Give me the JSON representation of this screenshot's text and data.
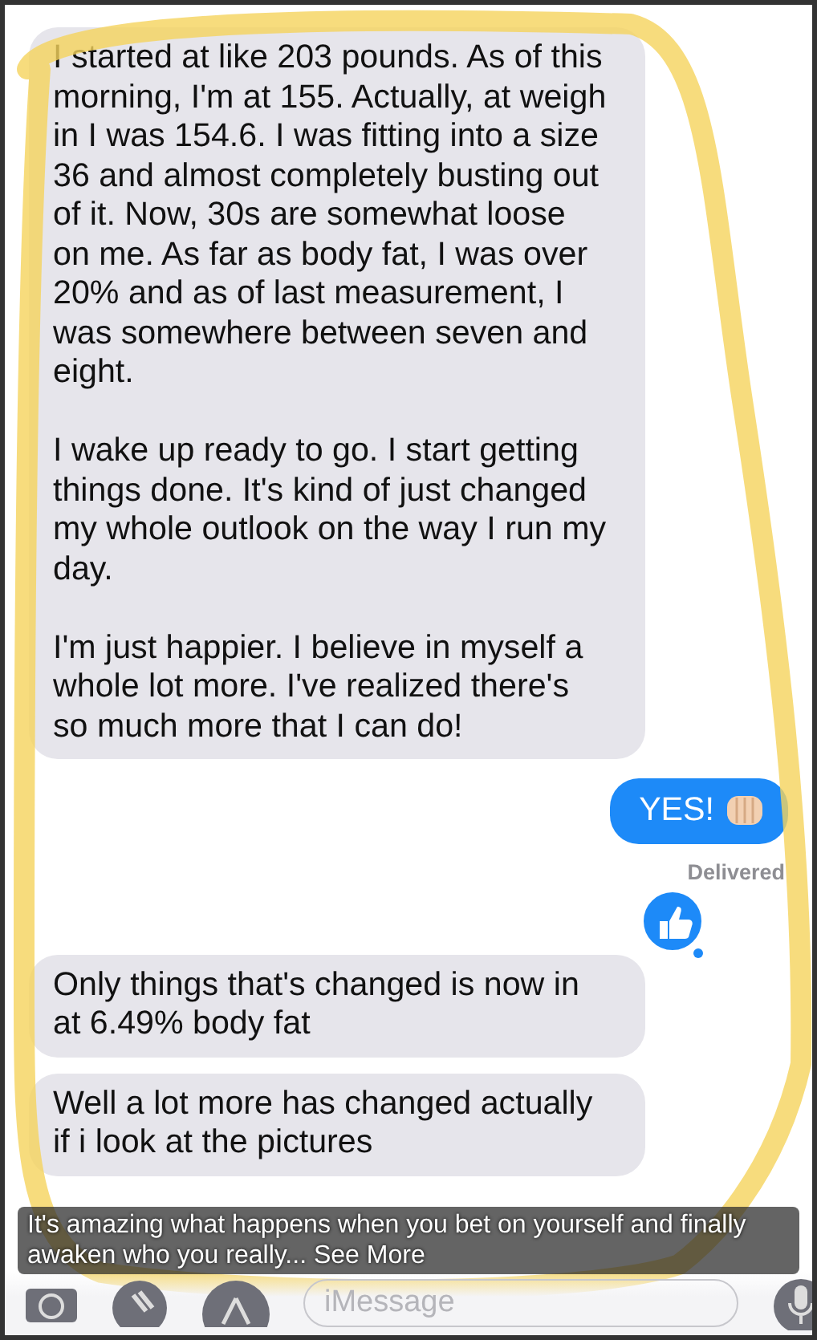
{
  "messages": [
    {
      "kind": "received",
      "paragraphs": [
        "I started at like 203 pounds. As of this morning, I'm at 155. Actually, at weigh in I was 154.6. I was fitting into a size 36 and almost completely busting out of it. Now, 30s are somewhat loose on me. As far as body fat,  I was over 20% and as of last measurement, I was somewhere between seven and eight.",
        "I wake up ready to go. I start getting things done. It's kind of just changed my whole outlook on the way I run my day.",
        "I'm just happier. I believe in myself a whole lot more. I've realized there's so much more that I can do!"
      ],
      "liked": false
    },
    {
      "kind": "sent",
      "paragraphs": [
        "YES!"
      ],
      "status": "Delivered",
      "liked": false
    },
    {
      "kind": "received",
      "paragraphs": [
        "Only things that's changed is now in at 6.49% body fat"
      ],
      "liked": true
    },
    {
      "kind": "received",
      "paragraphs": [
        "Well a lot more has changed actually if i look at the pictures"
      ],
      "liked": false
    }
  ],
  "composer": {
    "placeholder": "iMessage"
  },
  "caption": {
    "text": "It's amazing what happens when you bet on yourself and finally awaken who you really...",
    "link": "See More"
  }
}
